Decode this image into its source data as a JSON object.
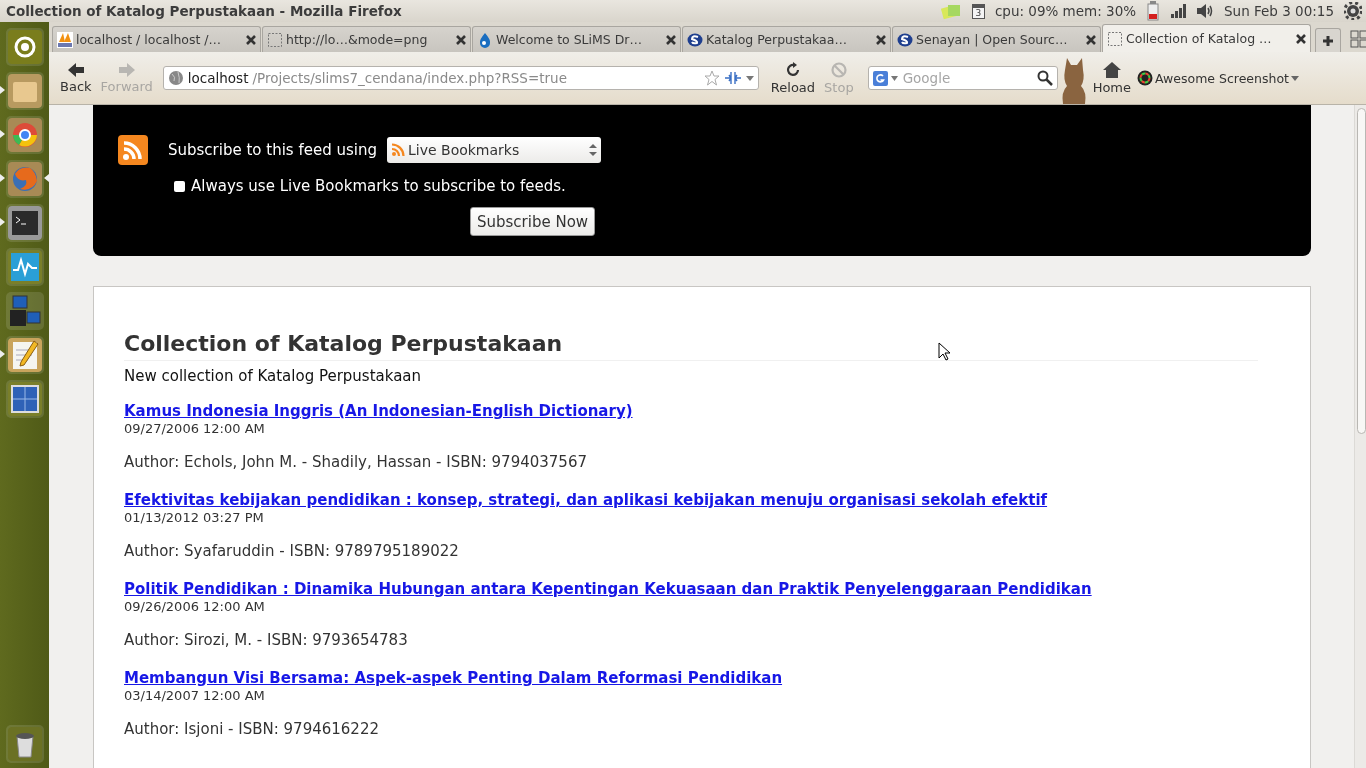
{
  "top_panel": {
    "window_title": "Collection of Katalog Perpustakaan - Mozilla Firefox",
    "calendar_day": "3",
    "system_monitor": "cpu: 09% mem: 30%",
    "clock": "Sun Feb  3  00:15"
  },
  "launcher": {
    "items": [
      {
        "kind": "dash",
        "running": false,
        "focused": false
      },
      {
        "kind": "files",
        "running": true,
        "focused": false
      },
      {
        "kind": "chrome",
        "running": true,
        "focused": false
      },
      {
        "kind": "firefox",
        "running": true,
        "focused": true
      },
      {
        "kind": "terminal",
        "running": true,
        "focused": false
      },
      {
        "kind": "monitor",
        "running": false,
        "focused": false
      },
      {
        "kind": "network",
        "running": false,
        "focused": false
      },
      {
        "kind": "editor",
        "running": true,
        "focused": false
      },
      {
        "kind": "workspaces",
        "running": false,
        "focused": false
      }
    ],
    "trash": {
      "kind": "trash"
    }
  },
  "tabs": [
    {
      "label": "localhost / localhost /…",
      "kind": "pma",
      "selected": false
    },
    {
      "label": "http://lo…&mode=png",
      "kind": "blank",
      "selected": false
    },
    {
      "label": "Welcome to SLiMS Dr…",
      "kind": "drop",
      "selected": false
    },
    {
      "label": "Katalog Perpustakaa…",
      "kind": "slims",
      "selected": false
    },
    {
      "label": "Senayan | Open Sourc…",
      "kind": "slims",
      "selected": false
    },
    {
      "label": "Collection of Katalog …",
      "kind": "blank",
      "selected": true
    }
  ],
  "toolbar": {
    "back": {
      "label": "Back",
      "disabled": false
    },
    "forward": {
      "label": "Forward",
      "disabled": true
    },
    "url_host": "localhost",
    "url_path": "/Projects/slims7_cendana/index.php?RSS=true",
    "reload": {
      "label": "Reload",
      "disabled": false
    },
    "stop": {
      "label": "Stop",
      "disabled": true
    },
    "search": {
      "placeholder": "Google"
    },
    "home": "Home",
    "addon": "Awesome Screenshot"
  },
  "feed_header": {
    "subscribe_label": "Subscribe to this feed using",
    "reader": "Live Bookmarks",
    "always_use": {
      "label": "Always use Live Bookmarks to subscribe to feeds.",
      "checked": false
    },
    "button": "Subscribe Now"
  },
  "feed": {
    "title": "Collection of Katalog Perpustakaan",
    "subtitle": "New collection of Katalog Perpustakaan",
    "items": [
      {
        "title": "Kamus Indonesia Inggris (An Indonesian-English Dictionary)",
        "date": "09/27/2006 12:00 AM",
        "details": "Author: Echols, John M. - Shadily, Hassan - ISBN: 9794037567"
      },
      {
        "title": "Efektivitas kebijakan pendidikan : konsep, strategi, dan aplikasi kebijakan menuju organisasi sekolah efektif",
        "date": "01/13/2012 03:27 PM",
        "details": "Author: Syafaruddin - ISBN: 9789795189022"
      },
      {
        "title": "Politik Pendidikan : Dinamika Hubungan antara Kepentingan Kekuasaan dan Praktik Penyelenggaraan Pendidikan",
        "date": "09/26/2006 12:00 AM",
        "details": "Author: Sirozi, M. - ISBN: 9793654783"
      },
      {
        "title": "Membangun Visi Bersama: Aspek-aspek Penting Dalam Reformasi Pendidikan",
        "date": "03/14/2007 12:00 AM",
        "details": "Author: Isjoni - ISBN: 9794616222"
      }
    ]
  }
}
